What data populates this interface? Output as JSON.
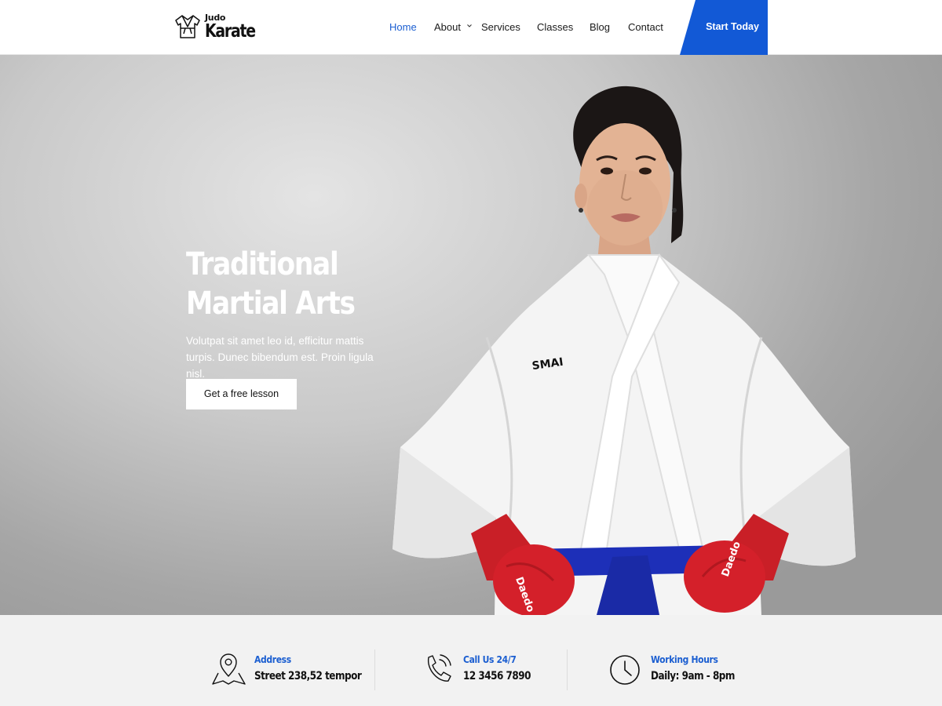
{
  "brand": {
    "top": "Judo",
    "main": "Karate"
  },
  "nav": {
    "items": [
      "Home",
      "About",
      "Services",
      "Classes",
      "Blog",
      "Contact"
    ],
    "active": "Home",
    "cta": "Start Today"
  },
  "hero": {
    "title_line1": "Traditional",
    "title_line2": "Martial Arts",
    "text": "Volutpat sit amet leo id, efficitur mattis turpis. Dunec bibendum est. Proin ligula nisl.",
    "button": "Get a free lesson",
    "figure_logo": "SMAI"
  },
  "info": [
    {
      "icon": "map-pin-icon",
      "label": "Address",
      "value": "Street 238,52 tempor"
    },
    {
      "icon": "phone-icon",
      "label": "Call Us 24/7",
      "value": "12 3456 7890"
    },
    {
      "icon": "clock-icon",
      "label": "Working Hours",
      "value": "Daily: 9am - 8pm"
    }
  ],
  "colors": {
    "accent": "#1c5fd1",
    "cta_bg": "#1259d6",
    "belt": "#1d2fb8",
    "gloves": "#d4202a"
  }
}
